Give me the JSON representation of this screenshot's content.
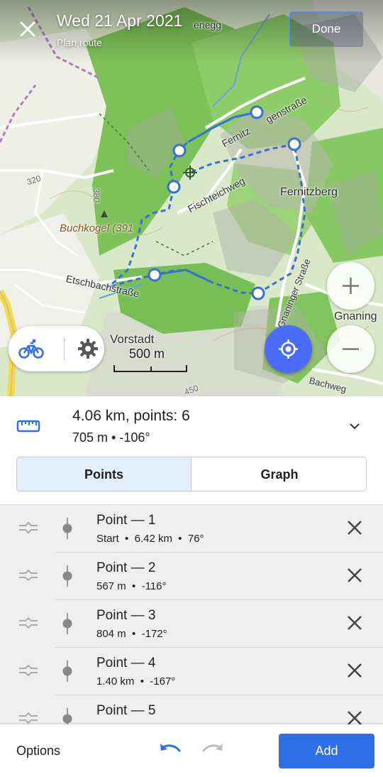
{
  "header": {
    "title": "Wed 21 Apr 2021",
    "subtitle": "Plan route",
    "done_label": "Done"
  },
  "map": {
    "labels": {
      "fernitzberg": "Fernitzberg",
      "buchkogel": "Buchkogel (391",
      "vorstadt": "Vorstadt",
      "gnaning": "Gnaning",
      "etschbachstrasse": "Etschbachstraße",
      "fischteichweg": "Fischteichweg",
      "gnaningerstrasse": "Gnaninger Straße",
      "fernitzgenstrasse": "Fernitz",
      "genstrasse": "genstraße",
      "enegg": "enegg",
      "baeg": "Bachweg",
      "num320": "320",
      "num380": "380",
      "num450": "450"
    },
    "scale_label": "500 m",
    "route_color": "#3c6ed8"
  },
  "summary": {
    "distance": "4.06 km, points: 6",
    "elevation": "705 m • -106°"
  },
  "tabs": [
    {
      "label": "Points",
      "active": true
    },
    {
      "label": "Graph",
      "active": false
    }
  ],
  "points": [
    {
      "title": "Point — 1",
      "meta": "Start  •  6.42 km  •  76°"
    },
    {
      "title": "Point — 2",
      "meta": "567 m  •  -116°"
    },
    {
      "title": "Point — 3",
      "meta": "804 m  •  -172°"
    },
    {
      "title": "Point — 4",
      "meta": "1.40 km  •  -167°"
    },
    {
      "title": "Point — 5",
      "meta": ""
    }
  ],
  "bottom": {
    "options_label": "Options",
    "add_label": "Add"
  },
  "colors": {
    "accent": "#2d6fe8",
    "locate": "#4a6cf7",
    "tab_active_bg": "#e3effd"
  }
}
